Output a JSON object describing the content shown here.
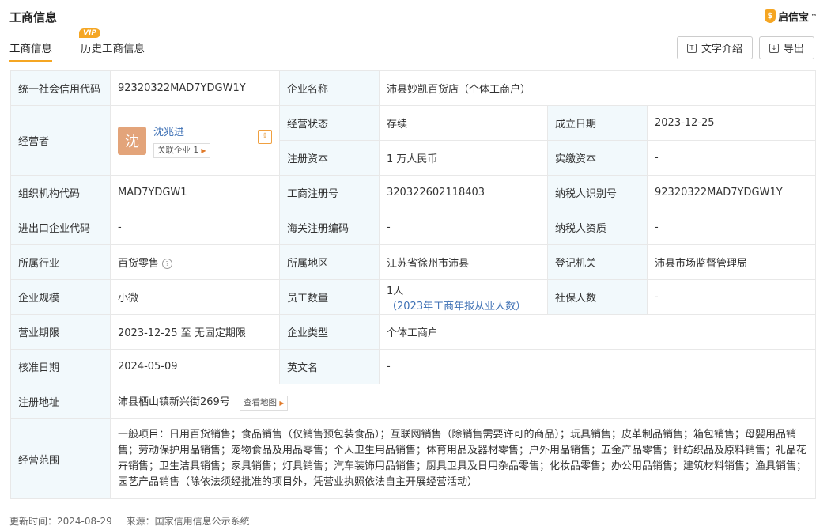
{
  "header": {
    "title": "工商信息",
    "logo_text": "启信宝",
    "logo_mark": "™"
  },
  "tabs": [
    {
      "label": "工商信息",
      "active": true
    },
    {
      "label": "历史工商信息",
      "badge": "VIP"
    }
  ],
  "toolbar": {
    "text_intro": "文字介绍",
    "export": "导出"
  },
  "info": {
    "credit_code_label": "统一社会信用代码",
    "credit_code": "92320322MAD7YDGW1Y",
    "company_name_label": "企业名称",
    "company_name": "沛县妙凯百货店（个体工商户）",
    "operator_label": "经营者",
    "operator_avatar": "沈",
    "operator_name": "沈兆进",
    "related_label": "关联企业 1",
    "status_label": "经营状态",
    "status": "存续",
    "found_date_label": "成立日期",
    "found_date": "2023-12-25",
    "reg_capital_label": "注册资本",
    "reg_capital": "1 万人民币",
    "paid_capital_label": "实缴资本",
    "paid_capital": "-",
    "org_code_label": "组织机构代码",
    "org_code": "MAD7YDGW1",
    "reg_no_label": "工商注册号",
    "reg_no": "320322602118403",
    "taxpayer_id_label": "纳税人识别号",
    "taxpayer_id": "92320322MAD7YDGW1Y",
    "import_export_label": "进出口企业代码",
    "import_export": "-",
    "customs_label": "海关注册编码",
    "customs": "-",
    "taxpayer_qual_label": "纳税人资质",
    "taxpayer_qual": "-",
    "industry_label": "所属行业",
    "industry": "百货零售",
    "region_label": "所属地区",
    "region": "江苏省徐州市沛县",
    "reg_authority_label": "登记机关",
    "reg_authority": "沛县市场监督管理局",
    "scale_label": "企业规模",
    "scale": "小微",
    "staff_label": "员工数量",
    "staff": "1人",
    "staff_note": "（2023年工商年报从业人数）",
    "social_label": "社保人数",
    "social": "-",
    "term_label": "营业期限",
    "term": "2023-12-25 至 无固定期限",
    "type_label": "企业类型",
    "type": "个体工商户",
    "approve_date_label": "核准日期",
    "approve_date": "2024-05-09",
    "en_name_label": "英文名",
    "en_name": "-",
    "address_label": "注册地址",
    "address": "沛县栖山镇新兴街269号",
    "map_button": "查看地图",
    "scope_label": "经营范围",
    "scope": "一般项目：日用百货销售；食品销售（仅销售预包装食品）；互联网销售（除销售需要许可的商品）；玩具销售；皮革制品销售；箱包销售；母婴用品销售；劳动保护用品销售；宠物食品及用品零售；个人卫生用品销售；体育用品及器材零售；户外用品销售；五金产品零售；针纺织品及原料销售；礼品花卉销售；卫生洁具销售；家具销售；灯具销售；汽车装饰用品销售；厨具卫具及日用杂品零售；化妆品零售；办公用品销售；建筑材料销售；渔具销售；园艺产品销售（除依法须经批准的项目外，凭营业执照依法自主开展经营活动）"
  },
  "footer": {
    "updated": "更新时间：2024-08-29",
    "source": "来源：国家信用信息公示系统"
  }
}
